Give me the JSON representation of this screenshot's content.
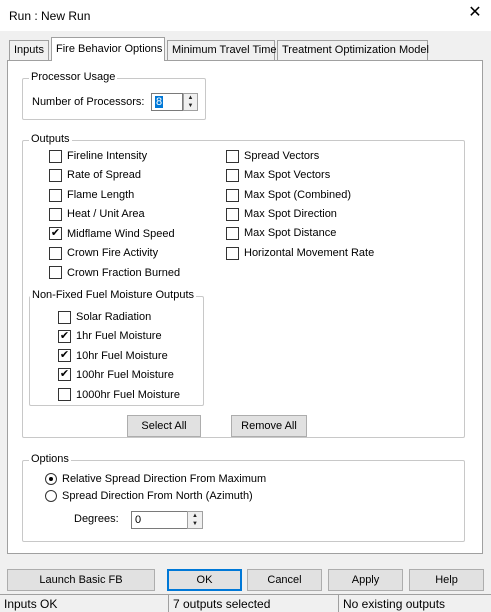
{
  "window": {
    "title": "Run : New Run",
    "close_glyph": "✕"
  },
  "tabs": [
    {
      "label": "Inputs",
      "active": false
    },
    {
      "label": "Fire Behavior Options",
      "active": true
    },
    {
      "label": "Minimum Travel Time",
      "active": false
    },
    {
      "label": "Treatment Optimization Model",
      "active": false
    }
  ],
  "processor_usage": {
    "title": "Processor Usage",
    "label": "Number of Processors:",
    "value": "8"
  },
  "outputs": {
    "title": "Outputs",
    "left": [
      {
        "label": "Fireline Intensity",
        "checked": false
      },
      {
        "label": "Rate of Spread",
        "checked": false
      },
      {
        "label": "Flame Length",
        "checked": false
      },
      {
        "label": "Heat / Unit Area",
        "checked": false
      },
      {
        "label": "Midflame Wind Speed",
        "checked": true
      },
      {
        "label": "Crown Fire Activity",
        "checked": false
      },
      {
        "label": "Crown Fraction Burned",
        "checked": false
      }
    ],
    "right": [
      {
        "label": "Spread Vectors",
        "checked": false
      },
      {
        "label": "Max Spot Vectors",
        "checked": false
      },
      {
        "label": "Max Spot (Combined)",
        "checked": false
      },
      {
        "label": "Max Spot Direction",
        "checked": false
      },
      {
        "label": "Max Spot Distance",
        "checked": false
      },
      {
        "label": "Horizontal Movement Rate",
        "checked": false
      }
    ],
    "moisture": {
      "title": "Non-Fixed Fuel Moisture Outputs",
      "items": [
        {
          "label": "Solar Radiation",
          "checked": false
        },
        {
          "label": "1hr Fuel Moisture",
          "checked": true
        },
        {
          "label": "10hr Fuel Moisture",
          "checked": true
        },
        {
          "label": "100hr Fuel Moisture",
          "checked": true
        },
        {
          "label": "1000hr Fuel Moisture",
          "checked": false
        }
      ]
    },
    "select_all": "Select All",
    "remove_all": "Remove All"
  },
  "options": {
    "title": "Options",
    "radios": [
      {
        "label": "Relative Spread Direction From Maximum",
        "checked": true
      },
      {
        "label": "Spread Direction From North (Azimuth)",
        "checked": false
      }
    ],
    "degrees_label": "Degrees:",
    "degrees_value": "0"
  },
  "buttons": {
    "launch": "Launch Basic FB",
    "ok": "OK",
    "cancel": "Cancel",
    "apply": "Apply",
    "help": "Help"
  },
  "status": [
    "Inputs OK",
    "7 outputs selected",
    "No existing outputs"
  ]
}
